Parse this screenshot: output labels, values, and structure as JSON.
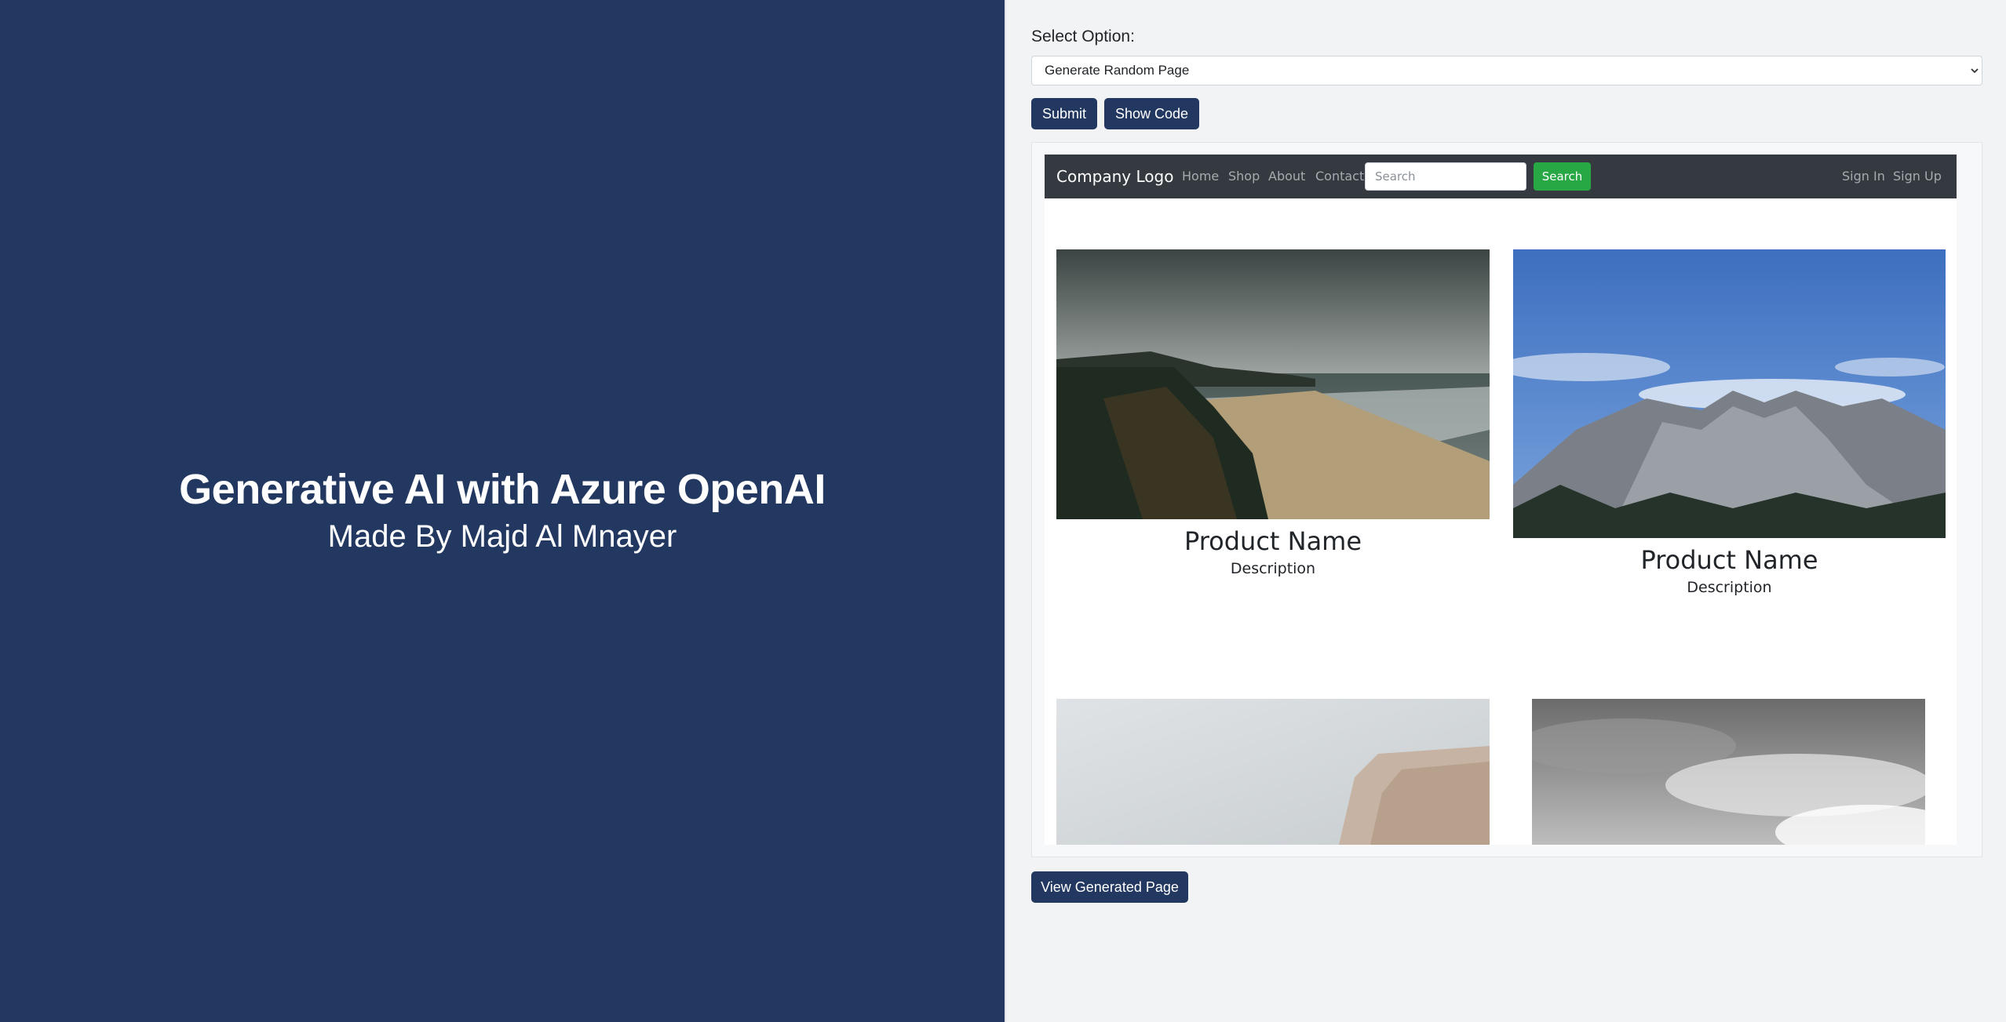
{
  "hero": {
    "title": "Generative AI with Azure OpenAI",
    "subtitle": "Made By Majd Al Mnayer"
  },
  "form": {
    "select_label": "Select Option:",
    "selected_option": "Generate Random Page",
    "submit_label": "Submit",
    "show_code_label": "Show Code",
    "view_generated_label": "View Generated Page"
  },
  "preview": {
    "brand": "Company Logo",
    "nav": [
      "Home",
      "Shop",
      "About",
      "Contact"
    ],
    "search_placeholder": "Search",
    "search_button": "Search",
    "auth": [
      "Sign In",
      "Sign Up"
    ],
    "products": [
      {
        "name": "Product Name",
        "description": "Description",
        "image": "coastal-beach-photo"
      },
      {
        "name": "Product Name",
        "description": "Description",
        "image": "mountain-peak-photo"
      },
      {
        "name": "",
        "description": "",
        "image": "foggy-cliff-photo"
      },
      {
        "name": "",
        "description": "",
        "image": "cloudy-sky-photo"
      }
    ]
  },
  "colors": {
    "primary": "#223860",
    "navbar": "#343a40",
    "search_button": "#28a745",
    "page_bg": "#f2f3f5"
  }
}
